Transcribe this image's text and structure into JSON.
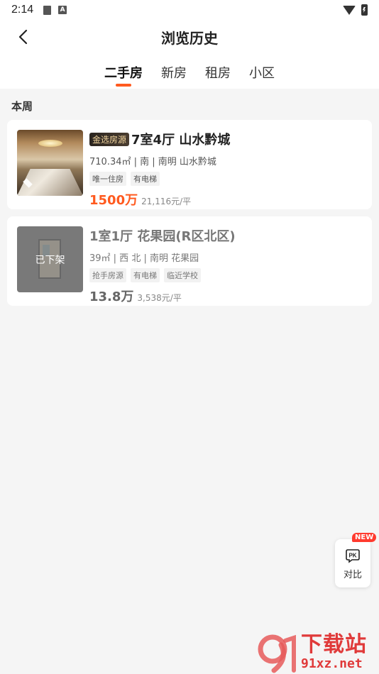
{
  "status": {
    "time": "2:14"
  },
  "header": {
    "title": "浏览历史"
  },
  "tabs": [
    {
      "label": "二手房",
      "active": true
    },
    {
      "label": "新房",
      "active": false
    },
    {
      "label": "租房",
      "active": false
    },
    {
      "label": "小区",
      "active": false
    }
  ],
  "section": {
    "label": "本周"
  },
  "listings": [
    {
      "badge": "金选房源",
      "title": "7室4厅 山水黔城",
      "meta": "710.34㎡ | 南 | 南明 山水黔城",
      "tags": [
        "唯一住房",
        "有电梯"
      ],
      "price": "1500万",
      "unit_price": "21,116元/平"
    },
    {
      "status": "已下架",
      "title": "1室1厅 花果园(R区北区)",
      "meta": "39㎡ | 西 北 | 南明 花果园",
      "tags": [
        "抢手房源",
        "有电梯",
        "临近学校"
      ],
      "price": "13.8万",
      "unit_price": "3,538元/平"
    }
  ],
  "compare": {
    "new_badge": "NEW",
    "label": "对比",
    "icon_text": "PK"
  },
  "watermark": {
    "text": "下载站",
    "url": "91xz.net"
  },
  "colors": {
    "accent": "#ff5a1f",
    "background": "#f5f5f5"
  }
}
